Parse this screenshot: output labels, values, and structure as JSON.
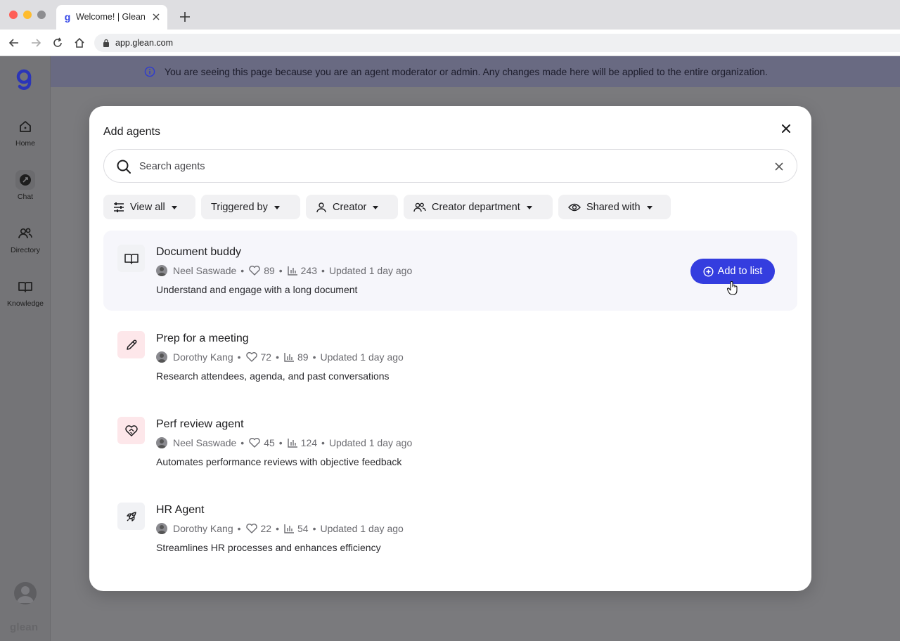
{
  "browser": {
    "tab_title": "Welcome! | Glean",
    "favicon": "g",
    "url": "app.glean.com"
  },
  "sidebar": {
    "items": [
      {
        "label": "Home",
        "icon": "home-icon"
      },
      {
        "label": "Chat",
        "icon": "chat-icon"
      },
      {
        "label": "Directory",
        "icon": "people-icon"
      },
      {
        "label": "Knowledge",
        "icon": "book-icon"
      }
    ],
    "wordmark": "glean"
  },
  "banner": {
    "text": "You are seeing this page because you are an agent moderator or admin. Any changes made here will be applied to the entire organization."
  },
  "modal": {
    "title": "Add agents",
    "search_placeholder": "Search agents",
    "filters": [
      {
        "label": "View all",
        "icon": "sliders-icon"
      },
      {
        "label": "Triggered by",
        "icon": ""
      },
      {
        "label": "Creator",
        "icon": "person-icon"
      },
      {
        "label": "Creator department",
        "icon": "people-icon"
      },
      {
        "label": "Shared with",
        "icon": "eye-icon"
      }
    ],
    "add_button_label": "Add to list",
    "agents": [
      {
        "title": "Document buddy",
        "creator": "Neel Saswade",
        "likes": "89",
        "uses": "243",
        "updated": "Updated 1 day ago",
        "description": "Understand and engage with a long document",
        "icon": "book-icon"
      },
      {
        "title": "Prep for a meeting",
        "creator": "Dorothy Kang",
        "likes": "72",
        "uses": "89",
        "updated": "Updated 1 day ago",
        "description": "Research attendees, agenda, and past conversations",
        "icon": "pencil-icon"
      },
      {
        "title": "Perf review agent",
        "creator": "Neel Saswade",
        "likes": "45",
        "uses": "124",
        "updated": "Updated 1 day ago",
        "description": "Automates performance reviews with objective feedback",
        "icon": "heart-handshake-icon"
      },
      {
        "title": "HR Agent",
        "creator": "Dorothy Kang",
        "likes": "22",
        "uses": "54",
        "updated": "Updated 1 day ago",
        "description": "Streamlines HR processes and enhances efficiency",
        "icon": "rocket-icon"
      }
    ]
  },
  "colors": {
    "accent": "#343ddf",
    "brand": "#3346e8",
    "icon_bg_pink": "#fde7ea",
    "icon_bg_gray": "#f1f2f5"
  }
}
